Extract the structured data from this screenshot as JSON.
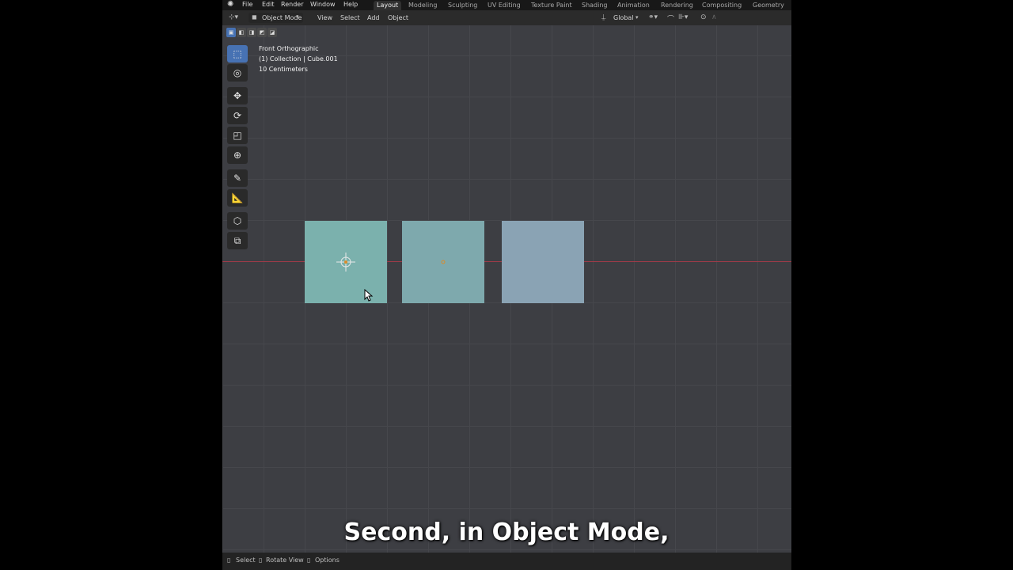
{
  "menubar": {
    "items": [
      "File",
      "Edit",
      "Render",
      "Window",
      "Help"
    ],
    "workspaces": [
      "Layout",
      "Modeling",
      "Sculpting",
      "UV Editing",
      "Texture Paint",
      "Shading",
      "Animation",
      "Rendering",
      "Compositing",
      "Geometry No"
    ],
    "active_workspace": "Layout"
  },
  "header": {
    "mode": "Object Mode",
    "menus": [
      "View",
      "Select",
      "Add",
      "Object"
    ],
    "orientation": "Global"
  },
  "viewport": {
    "view_name": "Front Orthographic",
    "collection_object": "(1) Collection | Cube.001",
    "grid_scale": "10 Centimeters",
    "cube_colors": [
      "#7bb1ad",
      "#7ea9ad",
      "#8aa3b4"
    ],
    "background": "#3d3e43",
    "x_axis_color": "#a13b48"
  },
  "toolbar": {
    "tools": [
      "select-box-icon",
      "cursor-icon",
      "move-icon",
      "rotate-icon",
      "scale-icon",
      "transform-icon",
      "annotate-icon",
      "measure-icon",
      "add-cube-icon",
      "extrude-icon"
    ],
    "active_tool": "select-box-icon"
  },
  "statusbar": {
    "items": [
      "Select",
      "Rotate View",
      "Options"
    ]
  },
  "caption": "Second, in Object Mode,"
}
